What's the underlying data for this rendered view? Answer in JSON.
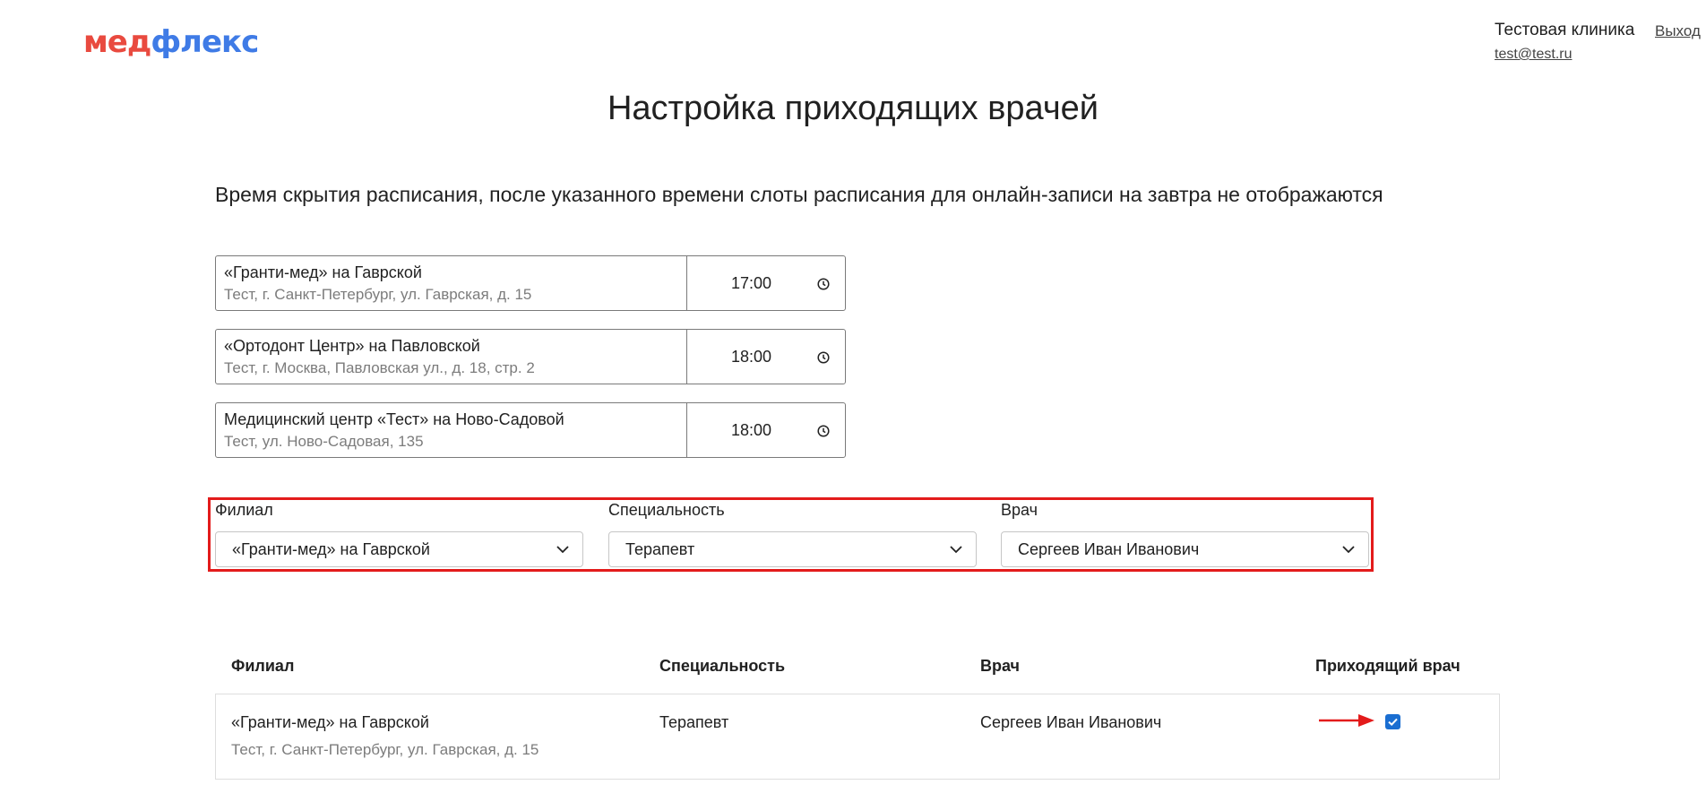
{
  "header": {
    "logo_part1": "мед",
    "logo_part2": "флекс",
    "clinic_name": "Тестовая клиника",
    "email": "test@test.ru",
    "logout": "Выход"
  },
  "page": {
    "title": "Настройка приходящих врачей",
    "subtitle": "Время скрытия расписания, после указанного времени слоты расписания для онлайн-записи на завтра не отображаются"
  },
  "branch_times": [
    {
      "name": "«Гранти-мед» на Гаврской",
      "address": "Тест, г. Санкт-Петербург, ул. Гаврская, д. 15",
      "time": "17:00"
    },
    {
      "name": "«Ортодонт Центр» на Павловской",
      "address": "Тест, г. Москва, Павловская ул., д. 18, стр. 2",
      "time": "18:00"
    },
    {
      "name": "Медицинский центр «Тест» на Ново-Садовой",
      "address": "Тест, ул. Ново-Садовая, 135",
      "time": "18:00"
    }
  ],
  "filters": {
    "branch": {
      "label": "Филиал",
      "value": "«Гранти-мед» на Гаврской"
    },
    "specialty": {
      "label": "Специальность",
      "value": "Терапевт"
    },
    "doctor": {
      "label": "Врач",
      "value": "Сергеев Иван Иванович"
    }
  },
  "table": {
    "headers": [
      "Филиал",
      "Специальность",
      "Врач",
      "Приходящий врач"
    ],
    "rows": [
      {
        "branch": "«Гранти-мед» на Гаврской",
        "branch_address": "Тест, г. Санкт-Петербург, ул. Гаврская, д. 15",
        "specialty": "Терапевт",
        "doctor": "Сергеев Иван Иванович",
        "visiting": true
      }
    ]
  },
  "colors": {
    "logo_red": "#e94a3f",
    "logo_blue": "#3f7be6",
    "highlight": "#e31b1b",
    "checkbox": "#1a6ed1"
  }
}
